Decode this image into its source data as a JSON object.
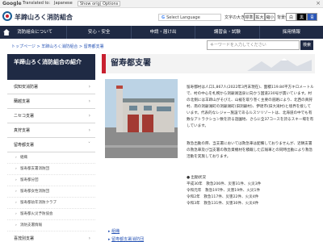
{
  "gbar": {
    "logo": "Google",
    "text1": "Translated to:",
    "text2": "Japanese",
    "text3": "",
    "btn_original": "Show original",
    "btn_options": "Options",
    "close": "×"
  },
  "header": {
    "site_title": "羊蹄山ろく消防組合",
    "translate_label": "Select Language",
    "font_size_label": "文字の大きさ",
    "font_buttons": [
      "標準",
      "拡大",
      "縮小"
    ],
    "bg_label": "背景色",
    "bg_buttons": [
      "白",
      "黒",
      "青"
    ]
  },
  "nav": {
    "items": [
      "消防組合について",
      "安心・安全",
      "申請・届け出",
      "講習会・試験",
      "採用情報"
    ]
  },
  "breadcrumb": "トップページ > 羊蹄山ろく消防組合 > 留寿都支署",
  "search": {
    "placeholder": "キーワードを入力してください",
    "button": "検索"
  },
  "sidebar": {
    "header": "羊蹄山ろく消防組合の紹介",
    "items": [
      {
        "label": "倶知安消防署"
      },
      {
        "label": "蘭越支署"
      },
      {
        "label": "ニセコ支署"
      },
      {
        "label": "真狩支署"
      },
      {
        "label": "留寿都支署"
      }
    ],
    "subitems": [
      "組織",
      "留寿都支署消防団",
      "留寿都分団",
      "留寿都女性消防団",
      "留寿都幼年消防クラブ",
      "留寿都火災予防協会",
      "消防支署情報"
    ],
    "tail": "喜茂別支署"
  },
  "main": {
    "title": "留寿都支署",
    "para1": "留寿都村は人口1,867人(2022年3月末現在)、面積119.84平方キロメートルで、村の中心を札幌から洞爺湖温泉に向かう国道230号が貫いています。村の北側には羊蹄山がそびえ、山裾を取り巻く主要の道路により、北西の真狩村、南の洞爺湖町の洞爺湖町(旧洞爺村)、伊達市(旧大滝村)と境界を接しています。代表的なレジャー施設であるルスツリゾートは、北海道の中でも有数なアトラクション数を誇る遊園地、さらに全37コースを誇るスキー場を有しています。",
    "para2": "救急出動の際、当支署においては救急車は配備しておりませんが、近隣支署の救急車及び当支署の救急資機材を積載した広報車との同時出動により救急活動を実施しております。",
    "stats_title": "出動状況",
    "stats": [
      "平成30年　救急206件、災害31件、火災3件",
      "令和元年　救急197件、災害19件、火災1件",
      "令和2年　救急117件、災害22件、火災4件",
      "令和3年　救急131件、災害30件、火災4件"
    ],
    "links": [
      "組織",
      "留寿都支署消防団"
    ]
  }
}
